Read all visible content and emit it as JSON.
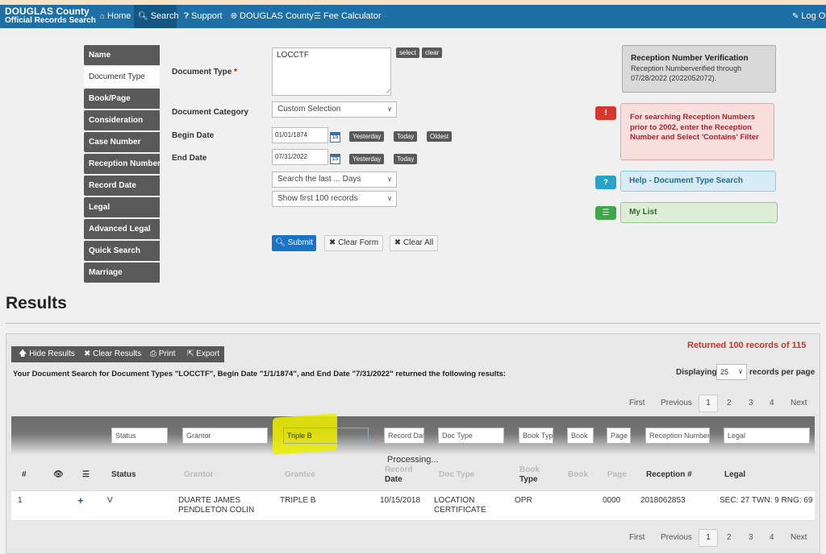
{
  "nav": {
    "brand_line1": "DOUGLAS County",
    "brand_line2": "Official Records Search",
    "home": "Home",
    "search": "Search",
    "support": "Support",
    "county": "DOUGLAS County",
    "fee": "Fee Calculator",
    "logout": "Log Ou"
  },
  "tabs": [
    "Name",
    "Document Type",
    "Book/Page",
    "Consideration",
    "Case Number",
    "Reception Number",
    "Record Date",
    "Legal",
    "Advanced Legal",
    "Quick Search",
    "Marriage"
  ],
  "form": {
    "doc_type_label": "Document Type",
    "doc_type_required": "*",
    "doc_type_value": "LOCCTF",
    "select_btn": "select",
    "clear_btn": "clear",
    "doc_category_label": "Document Category",
    "doc_category_value": "Custom Selection",
    "begin_date_label": "Begin Date",
    "begin_date_value": "01/01/1874",
    "end_date_label": "End Date",
    "end_date_value": "07/31/2022",
    "calendar_day": "15",
    "yesterday": "Yesterday",
    "today": "Today",
    "oldest": "Oldest",
    "search_last": "Search the last ... Days",
    "show_first": "Show first 100 records",
    "submit": "Submit",
    "clear_form": "Clear Form",
    "clear_all": "Clear All"
  },
  "panels": {
    "verify_title": "Reception Number Verification",
    "verify_text": "Reception Numberverified through 07/28/2022 (2022052072).",
    "alert_icon": "!",
    "alert_text": "For searching Reception Numbers prior to 2002, enter the Reception Number and Select 'Contains' Filter",
    "help_icon": "?",
    "help_text": "Help - Document Type Search",
    "mylist_text": "My List"
  },
  "results": {
    "title": "Results",
    "hide": "Hide Results",
    "clear": "Clear Results",
    "print": "Print",
    "export": "Export",
    "returned": "Returned 100 records of 115",
    "summary": "Your Document Search for Document Types \"LOCCTF\", Begin Date \"1/1/1874\", and End Date \"7/31/2022\" returned the following results:",
    "displaying": "Displaying",
    "per_page_value": "25",
    "per_page_label": "records per page",
    "processing": "Processing..."
  },
  "pager": {
    "first": "First",
    "previous": "Previous",
    "pages": [
      "1",
      "2",
      "3",
      "4"
    ],
    "next": "Next"
  },
  "filters": {
    "status": "Status",
    "grantor": "Grantor",
    "grantee_value": "Triple B",
    "record_date": "Record Dat",
    "doc_type": "Doc Type",
    "book_type": "Book Typ",
    "book": "Book",
    "page": "Page",
    "reception": "Reception Number",
    "legal": "Legal"
  },
  "table": {
    "headers": {
      "num": "#",
      "status": "Status",
      "grantor": "Grantor",
      "grantee": "Grantee",
      "record_date_1": "Record",
      "record_date_2": "Date",
      "doc_type": "Doc Type",
      "book_type_1": "Book",
      "book_type_2": "Type",
      "book": "Book",
      "page": "Page",
      "reception": "Reception #",
      "legal": "Legal"
    },
    "row": {
      "num": "1",
      "status": "V",
      "grantor_1": "DUARTE JAMES",
      "grantor_2": "PENDLETON COLIN",
      "grantee": "TRIPLE B",
      "record_date": "10/15/2018",
      "doc_type_1": "LOCATION",
      "doc_type_2": "CERTIFICATE",
      "book_type": "OPR",
      "page": "0000",
      "reception": "2018062853",
      "legal": "SEC: 27 TWN: 9 RNG: 69"
    }
  }
}
